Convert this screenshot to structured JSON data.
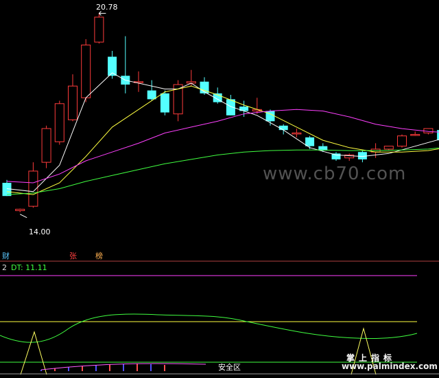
{
  "chart_data": [
    {
      "type": "candlestick",
      "high_label": "20.78",
      "low_label": "14.00",
      "price_range": [
        13.5,
        21.0
      ],
      "candles": [
        {
          "o": 15.0,
          "h": 15.1,
          "l": 14.55,
          "c": 14.55
        },
        {
          "o": 14.05,
          "h": 14.12,
          "l": 14.0,
          "c": 14.1
        },
        {
          "o": 14.2,
          "h": 15.7,
          "l": 14.15,
          "c": 15.4
        },
        {
          "o": 15.7,
          "h": 16.95,
          "l": 15.5,
          "c": 16.85
        },
        {
          "o": 16.4,
          "h": 17.8,
          "l": 16.3,
          "c": 17.7
        },
        {
          "o": 17.15,
          "h": 18.7,
          "l": 17.1,
          "c": 18.3
        },
        {
          "o": 17.9,
          "h": 19.9,
          "l": 17.75,
          "c": 19.7
        },
        {
          "o": 19.8,
          "h": 20.78,
          "l": 19.75,
          "c": 20.65
        },
        {
          "o": 19.3,
          "h": 19.5,
          "l": 18.55,
          "c": 18.65
        },
        {
          "o": 18.65,
          "h": 20.0,
          "l": 18.05,
          "c": 18.35
        },
        {
          "o": 18.45,
          "h": 18.8,
          "l": 18.1,
          "c": 18.45
        },
        {
          "o": 18.15,
          "h": 18.5,
          "l": 17.8,
          "c": 17.85
        },
        {
          "o": 18.05,
          "h": 18.15,
          "l": 17.3,
          "c": 17.4
        },
        {
          "o": 17.35,
          "h": 18.5,
          "l": 17.1,
          "c": 18.35
        },
        {
          "o": 18.4,
          "h": 18.85,
          "l": 18.3,
          "c": 18.45
        },
        {
          "o": 18.45,
          "h": 18.6,
          "l": 18.0,
          "c": 18.05
        },
        {
          "o": 18.05,
          "h": 18.25,
          "l": 17.7,
          "c": 17.75
        },
        {
          "o": 17.85,
          "h": 18.0,
          "l": 17.3,
          "c": 17.3
        },
        {
          "o": 17.6,
          "h": 17.8,
          "l": 17.25,
          "c": 17.45
        },
        {
          "o": 17.45,
          "h": 17.9,
          "l": 17.35,
          "c": 17.5
        },
        {
          "o": 17.45,
          "h": 17.5,
          "l": 16.95,
          "c": 17.1
        },
        {
          "o": 16.95,
          "h": 17.0,
          "l": 16.65,
          "c": 16.8
        },
        {
          "o": 16.7,
          "h": 16.85,
          "l": 16.55,
          "c": 16.7
        },
        {
          "o": 16.55,
          "h": 16.6,
          "l": 16.15,
          "c": 16.25
        },
        {
          "o": 16.25,
          "h": 16.35,
          "l": 16.05,
          "c": 16.1
        },
        {
          "o": 16.0,
          "h": 16.05,
          "l": 15.75,
          "c": 15.8
        },
        {
          "o": 15.85,
          "h": 16.0,
          "l": 15.75,
          "c": 15.95
        },
        {
          "o": 16.05,
          "h": 16.1,
          "l": 15.7,
          "c": 15.8
        },
        {
          "o": 16.05,
          "h": 16.35,
          "l": 15.85,
          "c": 16.15
        },
        {
          "o": 16.15,
          "h": 16.25,
          "l": 16.1,
          "c": 16.25
        },
        {
          "o": 16.25,
          "h": 16.65,
          "l": 16.2,
          "c": 16.6
        },
        {
          "o": 16.65,
          "h": 16.75,
          "l": 16.6,
          "c": 16.65
        },
        {
          "o": 16.7,
          "h": 16.85,
          "l": 16.65,
          "c": 16.85
        },
        {
          "o": 16.8,
          "h": 16.85,
          "l": 16.4,
          "c": 16.45
        },
        {
          "o": 16.35,
          "h": 17.5,
          "l": 16.3,
          "c": 17.3
        }
      ],
      "ma_lines": [
        {
          "color": "#ffffff",
          "points": [
            [
              0,
              14.8
            ],
            [
              2,
              14.7
            ],
            [
              4,
              15.6
            ],
            [
              6,
              17.9
            ],
            [
              8,
              18.75
            ],
            [
              9,
              18.5
            ],
            [
              12,
              18.2
            ],
            [
              13,
              18.2
            ],
            [
              14,
              18.4
            ],
            [
              15,
              18.1
            ],
            [
              17,
              17.6
            ],
            [
              19,
              17.3
            ],
            [
              21,
              16.8
            ],
            [
              23,
              16.2
            ],
            [
              25,
              15.95
            ],
            [
              27,
              15.9
            ],
            [
              29,
              16.0
            ],
            [
              31,
              16.25
            ],
            [
              33,
              16.5
            ],
            [
              34,
              16.65
            ]
          ]
        },
        {
          "color": "#ffff40",
          "points": [
            [
              0,
              14.7
            ],
            [
              2,
              14.6
            ],
            [
              4,
              15.0
            ],
            [
              6,
              15.9
            ],
            [
              8,
              16.9
            ],
            [
              10,
              17.5
            ],
            [
              12,
              18.1
            ],
            [
              14,
              18.3
            ],
            [
              16,
              18.0
            ],
            [
              18,
              17.65
            ],
            [
              20,
              17.35
            ],
            [
              22,
              16.9
            ],
            [
              24,
              16.45
            ],
            [
              26,
              16.2
            ],
            [
              28,
              16.05
            ],
            [
              30,
              16.05
            ],
            [
              32,
              16.1
            ],
            [
              34,
              16.25
            ]
          ]
        },
        {
          "color": "#ff40ff",
          "points": [
            [
              0,
              15.05
            ],
            [
              2,
              15.0
            ],
            [
              4,
              15.3
            ],
            [
              6,
              15.75
            ],
            [
              8,
              16.05
            ],
            [
              10,
              16.35
            ],
            [
              12,
              16.7
            ],
            [
              14,
              16.9
            ],
            [
              16,
              17.1
            ],
            [
              18,
              17.35
            ],
            [
              20,
              17.45
            ],
            [
              22,
              17.5
            ],
            [
              24,
              17.45
            ],
            [
              26,
              17.25
            ],
            [
              28,
              17.0
            ],
            [
              30,
              16.85
            ],
            [
              32,
              16.75
            ],
            [
              34,
              16.7
            ]
          ]
        },
        {
          "color": "#40ff40",
          "points": [
            [
              0,
              14.6
            ],
            [
              2,
              14.65
            ],
            [
              4,
              14.8
            ],
            [
              6,
              15.05
            ],
            [
              8,
              15.25
            ],
            [
              10,
              15.45
            ],
            [
              12,
              15.65
            ],
            [
              14,
              15.8
            ],
            [
              16,
              15.95
            ],
            [
              18,
              16.05
            ],
            [
              20,
              16.1
            ],
            [
              22,
              16.12
            ],
            [
              24,
              16.12
            ],
            [
              26,
              16.1
            ],
            [
              28,
              16.1
            ],
            [
              30,
              16.12
            ],
            [
              32,
              16.15
            ],
            [
              34,
              16.25
            ]
          ]
        }
      ]
    },
    {
      "type": "line",
      "title": "2",
      "series_label": "DT: 11.11",
      "legend_tags": [
        "财",
        "张",
        "榜"
      ],
      "zone_label": "安全区"
    }
  ],
  "watermarks": {
    "main": "www.cb70.com",
    "sub_top": "掌上指标",
    "sub_bottom": "www.palmindex.com"
  },
  "colors": {
    "up": "#ff3b3b",
    "down": "#54ffff",
    "axis": "#b04040"
  }
}
